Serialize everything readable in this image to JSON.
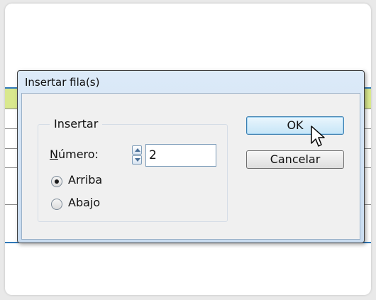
{
  "dialog": {
    "title": "Insertar fila(s)",
    "group_label": "Insertar",
    "numero_label_prefix": "N",
    "numero_label_rest": "úmero:",
    "numero_value": "2",
    "radio_above_label": "Arriba",
    "radio_below_label": "Abajo",
    "selected_option": "Arriba",
    "ok_label": "OK",
    "cancel_label": "Cancelar"
  },
  "colors": {
    "table_highlight": "#d9e88e",
    "table_border_blue": "#2f78b8",
    "dialog_frame": "#c9dcf0",
    "default_button": "#c6e5f7"
  }
}
